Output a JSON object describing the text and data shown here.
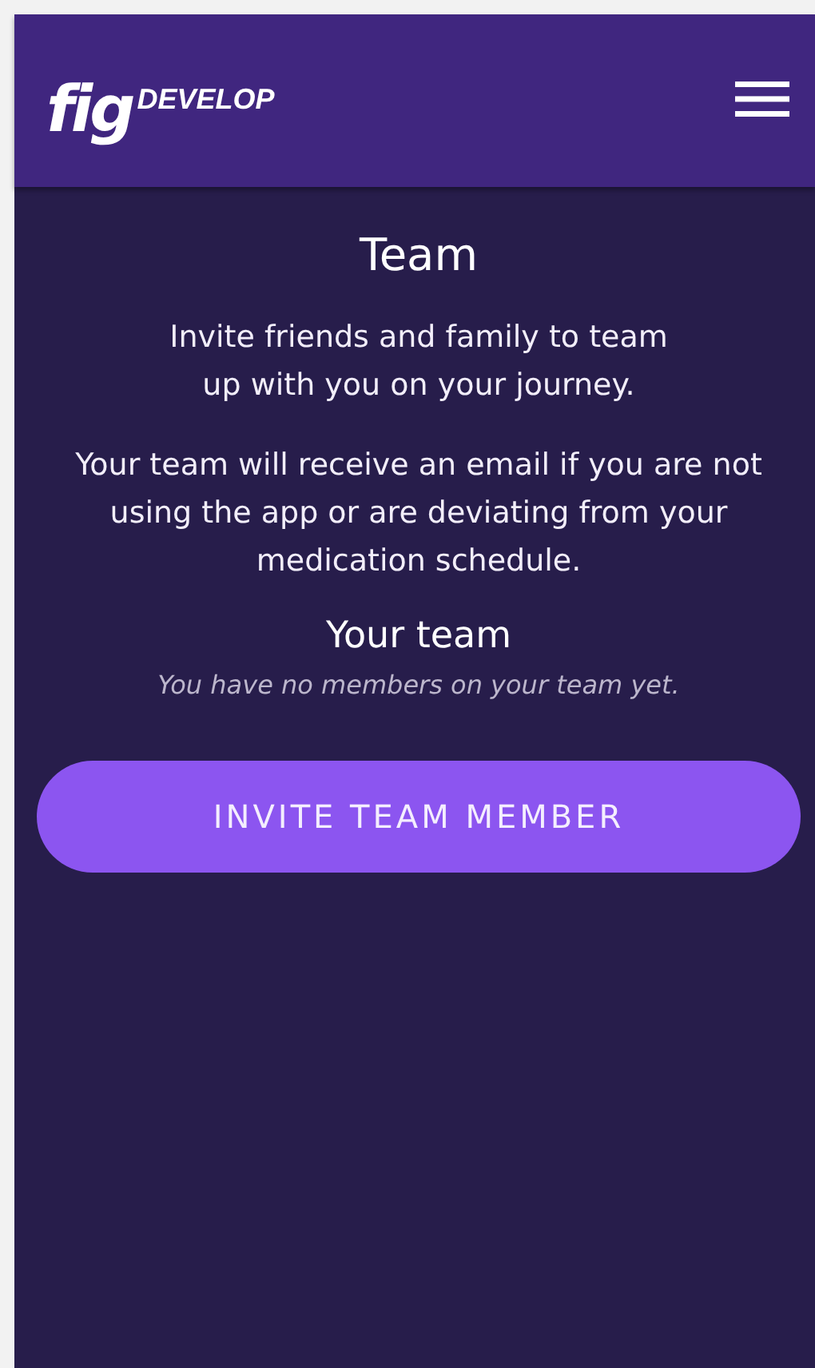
{
  "header": {
    "logo": "fig",
    "logo_suffix": "DEVELOP"
  },
  "title": "Team",
  "paragraphs": [
    "Invite friends and family to team up with you on your journey.",
    "Your team will receive an email if you are not using the app or are deviating from your medication schedule."
  ],
  "team": {
    "heading": "Your team",
    "empty_message": "You have no members on your team yet."
  },
  "button": "INVITE TEAM MEMBER"
}
